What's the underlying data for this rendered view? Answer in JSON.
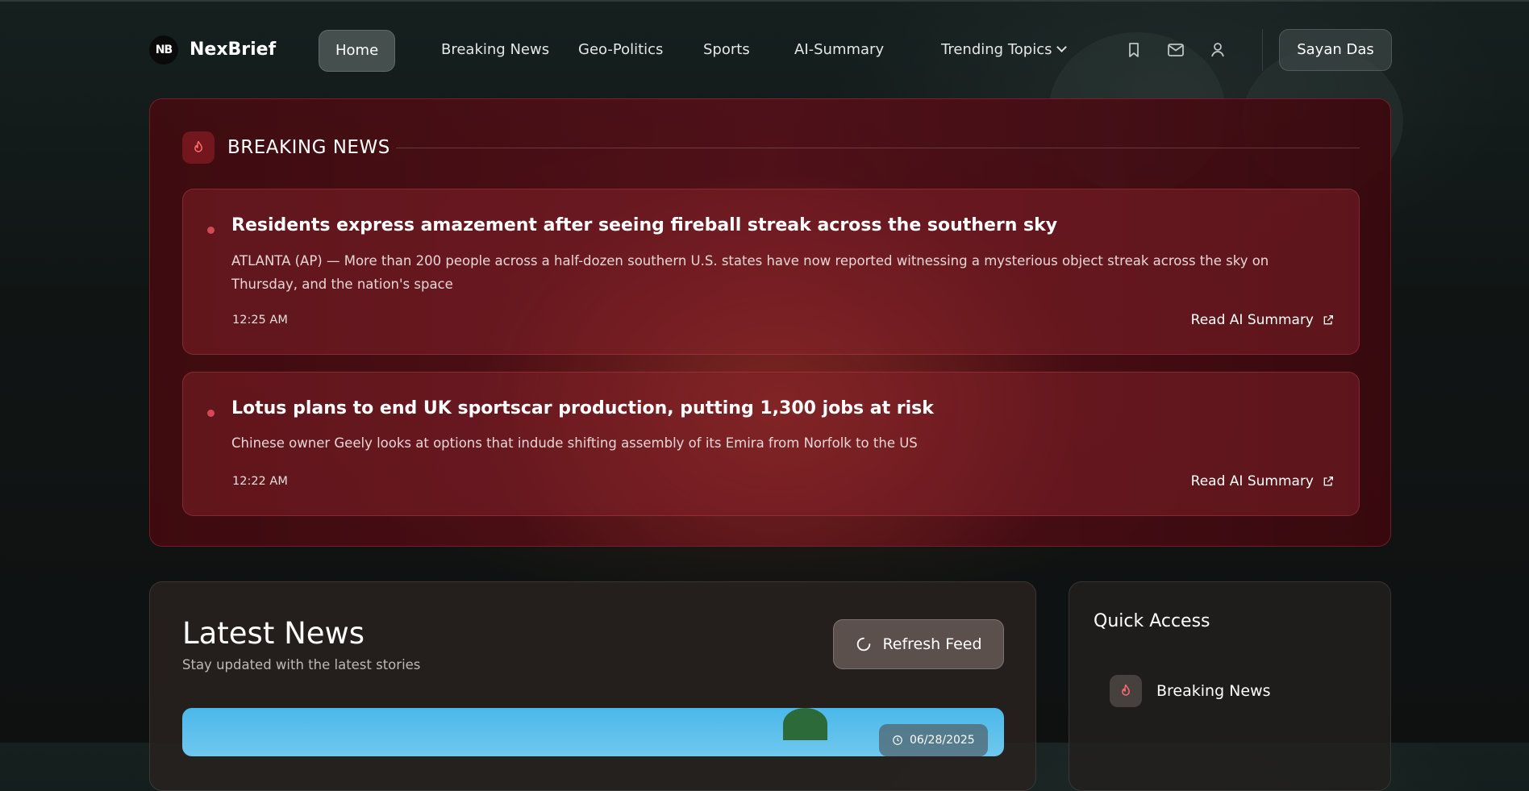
{
  "nav": {
    "logo_text": "NB",
    "brand": "NexBrief",
    "items": [
      {
        "label": "Home",
        "active": true
      },
      {
        "label": "Breaking News",
        "active": false
      },
      {
        "label": "Geo-Politics",
        "active": false
      },
      {
        "label": "Sports",
        "active": false
      },
      {
        "label": "AI-Summary",
        "active": false
      },
      {
        "label": "Trending Topics",
        "active": false
      }
    ],
    "icons": [
      "bookmark-icon",
      "mail-icon",
      "user-icon"
    ],
    "user_name": "Sayan Das"
  },
  "breaking": {
    "title": "BREAKING NEWS",
    "accent": "#d24a55",
    "items": [
      {
        "headline": "Residents express amazement after seeing fireball streak across the southern sky",
        "description": "ATLANTA (AP) — More than 200 people across a half-dozen southern U.S. states have now reported witnessing a mysterious object streak across the sky on Thursday, and the nation's space",
        "time": "12:25 AM",
        "link_label": "Read AI Summary"
      },
      {
        "headline": "Lotus plans to end UK sportscar production, putting 1,300 jobs at risk",
        "description": "Chinese owner Geely looks at options that indude shifting assembly of its Emira from Norfolk to the US",
        "time": "12:22 AM",
        "link_label": "Read AI Summary"
      }
    ]
  },
  "latest": {
    "title": "Latest News",
    "subtitle": "Stay updated with the latest stories",
    "refresh_label": "Refresh Feed",
    "first_card_date": "06/28/2025"
  },
  "quick_access": {
    "title": "Quick Access",
    "items": [
      {
        "label": "Breaking News",
        "icon": "flame-icon"
      }
    ]
  }
}
